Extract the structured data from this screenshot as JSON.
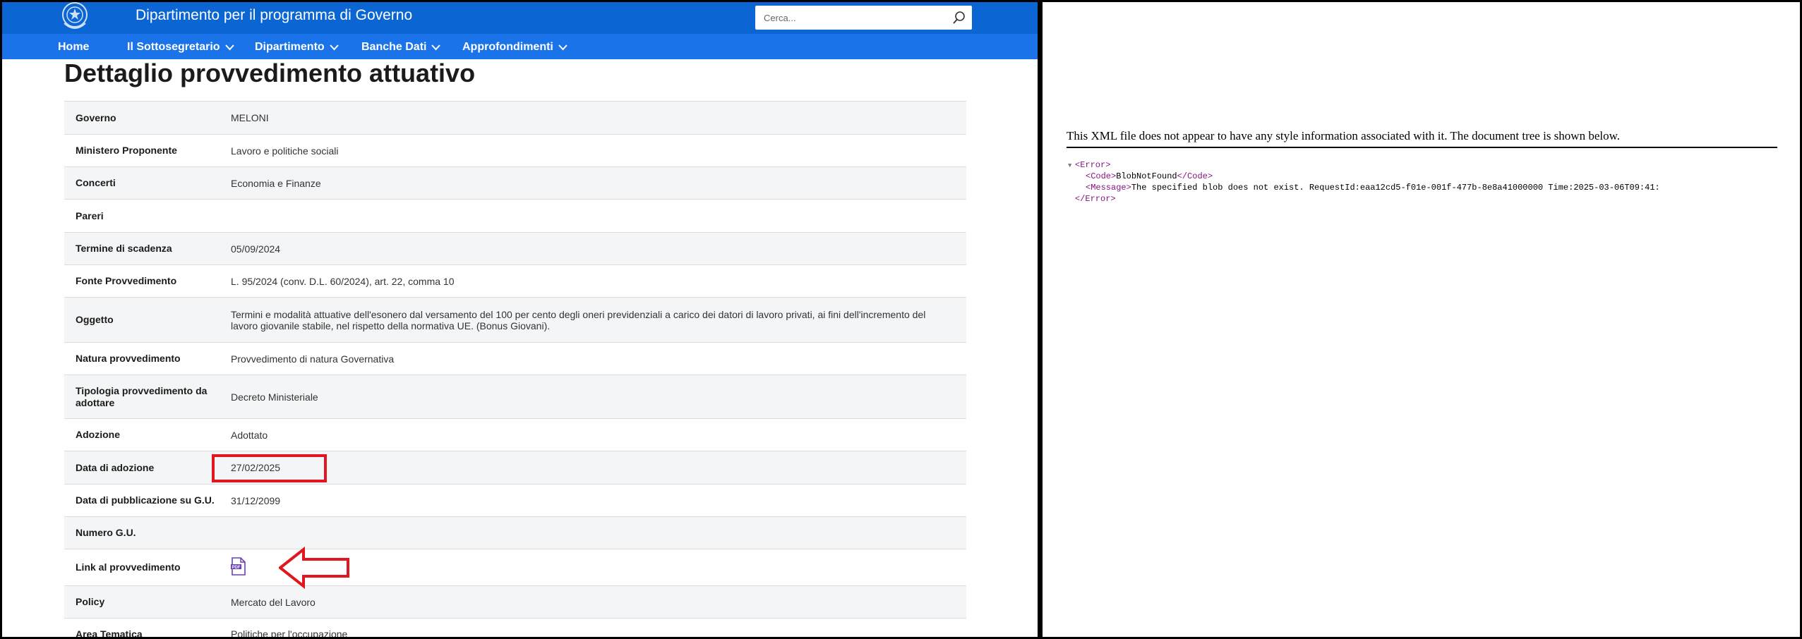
{
  "site": {
    "title": "Dipartimento per il programma di Governo",
    "search_placeholder": "Cerca...",
    "nav": [
      {
        "label": "Home",
        "has_dropdown": false
      },
      {
        "label": "Il Sottosegretario",
        "has_dropdown": true
      },
      {
        "label": "Dipartimento",
        "has_dropdown": true
      },
      {
        "label": "Banche Dati",
        "has_dropdown": true
      },
      {
        "label": "Approfondimenti",
        "has_dropdown": true
      }
    ],
    "colors": {
      "header": "#0b66d4",
      "nav": "#1a73e8",
      "highlight": "#e0171f",
      "pdf_icon": "#6a3fb5"
    }
  },
  "page": {
    "title": "Dettaglio provvedimento attuativo",
    "rows": [
      {
        "label": "Governo",
        "value": "MELONI"
      },
      {
        "label": "Ministero Proponente",
        "value": "Lavoro e politiche sociali"
      },
      {
        "label": "Concerti",
        "value": "Economia e Finanze"
      },
      {
        "label": "Pareri",
        "value": ""
      },
      {
        "label": "Termine di scadenza",
        "value": "05/09/2024"
      },
      {
        "label": "Fonte Provvedimento",
        "value": "L. 95/2024 (conv. D.L. 60/2024), art. 22, comma 10"
      },
      {
        "label": "Oggetto",
        "value": "Termini e modalità attuative dell'esonero dal versamento del 100 per cento degli oneri previdenziali a carico dei datori di lavoro privati, ai fini dell'incremento del lavoro giovanile stabile, nel rispetto della normativa UE. (Bonus Giovani)."
      },
      {
        "label": "Natura provvedimento",
        "value": "Provvedimento di natura Governativa"
      },
      {
        "label": "Tipologia provvedimento da adottare",
        "value": "Decreto Ministeriale"
      },
      {
        "label": "Adozione",
        "value": "Adottato"
      },
      {
        "label": "Data di adozione",
        "value": "27/02/2025"
      },
      {
        "label": "Data di pubblicazione su G.U.",
        "value": "31/12/2099"
      },
      {
        "label": "Numero G.U.",
        "value": ""
      },
      {
        "label": "Link al provvedimento",
        "value": "",
        "icon": "pdf-file-icon"
      },
      {
        "label": "Policy",
        "value": "Mercato del Lavoro"
      },
      {
        "label": "Area Tematica",
        "value": "Politiche per l'occupazione"
      }
    ]
  },
  "xml_viewer": {
    "info": "This XML file does not appear to have any style information associated with it. The document tree is shown below.",
    "root_open": "<Error>",
    "code_open": "<Code>",
    "code_text": "BlobNotFound",
    "code_close": "</Code>",
    "message_open": "<Message>",
    "message_text": "The specified blob does not exist. RequestId:eaa12cd5-f01e-001f-477b-8e8a41000000 Time:2025-03-06T09:41:",
    "root_close": "</Error>"
  }
}
